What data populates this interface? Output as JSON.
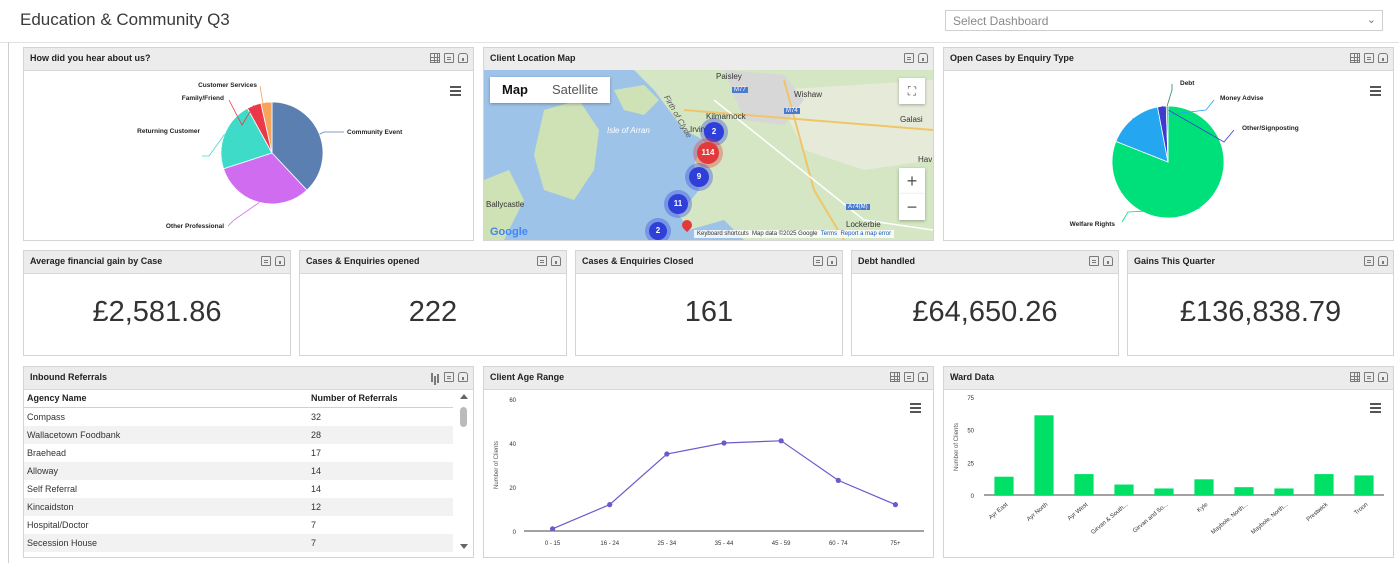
{
  "header": {
    "title": "Education & Community Q3",
    "dashboard_select": {
      "placeholder": "Select Dashboard"
    }
  },
  "colors": {
    "panel_header": "#ececec",
    "line_series": "#6a5acd",
    "bar_series": "#00e066",
    "cluster_blue": "#2f3fd9",
    "cluster_red": "#e23a3a",
    "green_slice": "#00e07a"
  },
  "panels": {
    "hear_about": {
      "title": "How did you hear about us?"
    },
    "map": {
      "title": "Client Location Map",
      "map_button": "Map",
      "satellite_button": "Satellite",
      "place_labels": [
        "Paisley",
        "Wishaw",
        "Kilmarnock",
        "Isle of Arran",
        "Irvine",
        "Firth of Clyde",
        "Galasi",
        "Hav",
        "Ballycastle",
        "Lockerbie",
        "M77",
        "M74",
        "A74(M)"
      ],
      "clusters": [
        "2",
        "114",
        "9",
        "11",
        "2"
      ],
      "footer": [
        "Keyboard shortcuts",
        "Map data ©2025 Google",
        "Terms",
        "Report a map error"
      ],
      "google_logo": "Google"
    },
    "open_cases": {
      "title": "Open Cases by Enquiry Type"
    },
    "kpis": [
      {
        "title": "Average financial gain by Case",
        "value": "£2,581.86"
      },
      {
        "title": "Cases & Enquiries opened",
        "value": "222"
      },
      {
        "title": "Cases & Enquiries Closed",
        "value": "161"
      },
      {
        "title": "Debt handled",
        "value": "£64,650.26"
      },
      {
        "title": "Gains This Quarter",
        "value": "£136,838.79"
      }
    ],
    "referrals": {
      "title": "Inbound Referrals",
      "columns": [
        "Agency Name",
        "Number of Referrals"
      ],
      "rows": [
        [
          "Compass",
          "32"
        ],
        [
          "Wallacetown Foodbank",
          "28"
        ],
        [
          "Braehead",
          "17"
        ],
        [
          "Alloway",
          "14"
        ],
        [
          "Self Referral",
          "14"
        ],
        [
          "Kincaidston",
          "12"
        ],
        [
          "Hospital/Doctor",
          "7"
        ],
        [
          "Secession House",
          "7"
        ]
      ]
    },
    "age": {
      "title": "Client Age Range"
    },
    "ward": {
      "title": "Ward Data"
    }
  },
  "chart_data": [
    {
      "type": "pie",
      "title": "How did you hear about us?",
      "labels": [
        "Community Event",
        "Other Professional",
        "Returning Customer",
        "Family/Friend",
        "Customer Services"
      ],
      "values": [
        38,
        32,
        22,
        4.5,
        3.5
      ],
      "colors": [
        "#5b7fb0",
        "#cf6cf0",
        "#3fdbc9",
        "#ea3a4a",
        "#f5a45c"
      ]
    },
    {
      "type": "pie",
      "title": "Open Cases by Enquiry Type",
      "labels": [
        "Welfare Rights",
        "Money Advise",
        "Other/Signposting",
        "Debt"
      ],
      "values": [
        81,
        16,
        2.5,
        0.5
      ],
      "colors": [
        "#00e07a",
        "#25a6f0",
        "#3b3bcf",
        "#2a8a55"
      ]
    },
    {
      "type": "line",
      "title": "Client Age Range",
      "ylabel": "Number of Clients",
      "categories": [
        "0 - 15",
        "16 - 24",
        "25 - 34",
        "35 - 44",
        "45 - 59",
        "60 - 74",
        "75+"
      ],
      "values": [
        1,
        12,
        35,
        40,
        41,
        23,
        12
      ],
      "yticks": [
        "0",
        "20",
        "40",
        "60"
      ],
      "ylim": [
        0,
        60
      ],
      "grid": false
    },
    {
      "type": "bar",
      "title": "Ward Data",
      "ylabel": "Number of Clients",
      "categories": [
        "Ayr East",
        "Ayr North",
        "Ayr West",
        "Girvan & South...",
        "Girvan and So...",
        "Kyle",
        "Maybole, North...",
        "Maybole, North...",
        "Prestwick",
        "Troon"
      ],
      "values": [
        14,
        61,
        16,
        8,
        5,
        12,
        6,
        5,
        16,
        15
      ],
      "yticks": [
        "0",
        "25",
        "50",
        "75"
      ],
      "ylim": [
        0,
        75
      ],
      "grid": false
    }
  ]
}
